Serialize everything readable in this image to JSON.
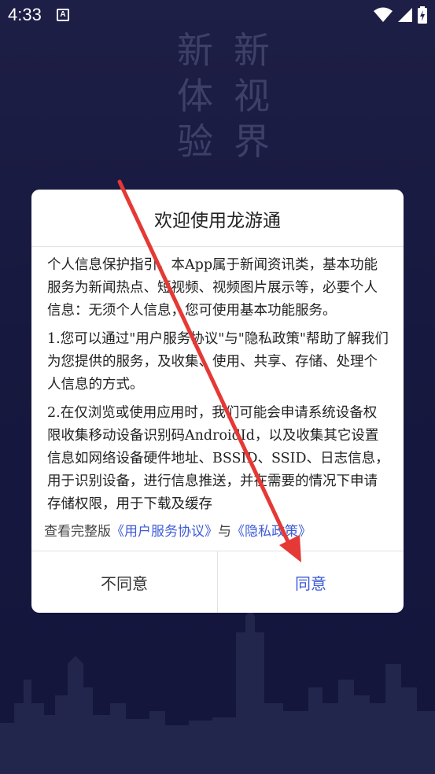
{
  "status_bar": {
    "time": "4:33",
    "notification_icon": "a-icon",
    "icons": [
      "wifi-icon",
      "signal-icon",
      "battery-charging-icon"
    ]
  },
  "background": {
    "slogan": [
      "新",
      "新",
      "体",
      "视",
      "验",
      "界"
    ]
  },
  "dialog": {
    "title": "欢迎使用龙游通",
    "paragraphs": [
      "个人信息保护指引，本App属于新闻资讯类，基本功能服务为新闻热点、短视频、视频图片展示等，必要个人信息：无须个人信息，您可使用基本功能服务。",
      "1.您可以通过\"用户服务协议\"与\"隐私政策\"帮助了解我们为您提供的服务，及收集、使用、共享、存储、处理个人信息的方式。",
      "2.在仅浏览或使用应用时，我们可能会申请系统设备权限收集移动设备识别码AndroidId，以及收集其它设置信息如网络设备硬件地址、BSSID、SSID、日志信息，用于识别设备，进行信息推送，并在需要的情况下申请存储权限，用于下载及缓存"
    ],
    "view_full": {
      "prefix": "查看完整版",
      "user_agreement_link": "《用户服务协议》",
      "conjunction": "与",
      "privacy_policy_link": "《隐私政策》"
    },
    "buttons": {
      "disagree": "不同意",
      "agree": "同意"
    }
  },
  "colors": {
    "background": "#1f2150",
    "accent_link": "#3d5bd6",
    "annotation_arrow": "#e53935"
  }
}
